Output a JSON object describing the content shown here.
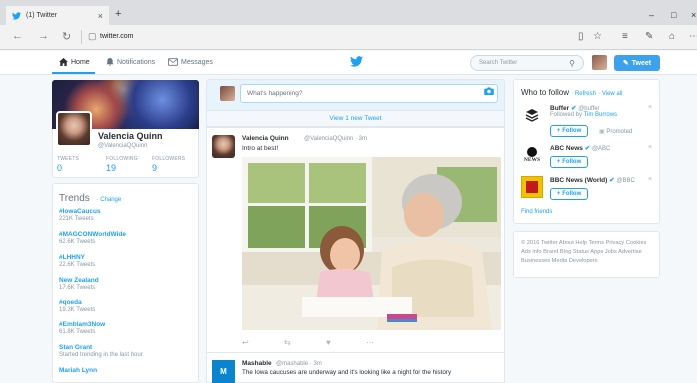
{
  "browser": {
    "tab_title": "(1) Twitter",
    "new_tab": "+",
    "url": "twitter.com",
    "window_minimize": "–",
    "window_maximize": "□",
    "window_close": "×"
  },
  "header": {
    "nav": [
      {
        "label": "Home",
        "icon": "home-icon",
        "active": true
      },
      {
        "label": "Notifications",
        "icon": "bell-icon",
        "active": false
      },
      {
        "label": "Messages",
        "icon": "envelope-icon",
        "active": false
      }
    ],
    "search_placeholder": "Search Twitter",
    "tweet_button": "Tweet"
  },
  "profile": {
    "name": "Valencia Quinn",
    "handle": "@ValenciaQQuinn",
    "stats": [
      {
        "label": "TWEETS",
        "value": "0"
      },
      {
        "label": "FOLLOWING",
        "value": "19"
      },
      {
        "label": "FOLLOWERS",
        "value": "9"
      }
    ]
  },
  "trends": {
    "title": "Trends",
    "change": "· Change",
    "items": [
      {
        "name": "#IowaCaucus",
        "sub": "221K Tweets"
      },
      {
        "name": "#MAGCONWorldWide",
        "sub": "62.6K Tweets"
      },
      {
        "name": "#LHHNY",
        "sub": "22.6K Tweets"
      },
      {
        "name": "New Zealand",
        "sub": "17.6K Tweets"
      },
      {
        "name": "#qoeda",
        "sub": "19.3K Tweets"
      },
      {
        "name": "#Emblam3Now",
        "sub": "61.8K Tweets"
      },
      {
        "name": "Stan Grant",
        "sub": "Started trending in the last hour"
      },
      {
        "name": "Mariah Lynn",
        "sub": ""
      }
    ]
  },
  "compose": {
    "placeholder": "What's happening?",
    "new_tweets": "View 1 new Tweet"
  },
  "tweets": [
    {
      "name": "Valencia Quinn",
      "meta": "@ValenciaQQuinn · 3m",
      "text": "Intro at best!"
    },
    {
      "name": "Mashable",
      "meta": "@mashable · 3m",
      "text": "The Iowa caucuses are underway and it's looking like a night for the history"
    }
  ],
  "who_to_follow": {
    "title": "Who to follow",
    "refresh": "· Refresh",
    "view_all": "· View all",
    "follow_label": "Follow",
    "items": [
      {
        "name": "Buffer",
        "handle": "@buffer",
        "sub": "Followed by ",
        "sub_link": "Tim Burrows",
        "promo": "Promoted"
      },
      {
        "name": "ABC News",
        "handle": "@ABC",
        "sub": "",
        "sub_link": "",
        "promo": ""
      },
      {
        "name": "BBC News (World)",
        "handle": "@BBC",
        "sub": "",
        "sub_link": "",
        "promo": ""
      }
    ],
    "find_friends": "Find friends"
  },
  "footer": {
    "text": "© 2016 Twitter  About  Help  Terms  Privacy  Cookies  Ads info  Brand  Blog  Status  Apps  Jobs  Advertise  Businesses  Media  Developers"
  },
  "colors": {
    "accent": "#1da1f2",
    "tweet_button": "#3ea1ec",
    "page_bg": "#f5f8fa"
  }
}
